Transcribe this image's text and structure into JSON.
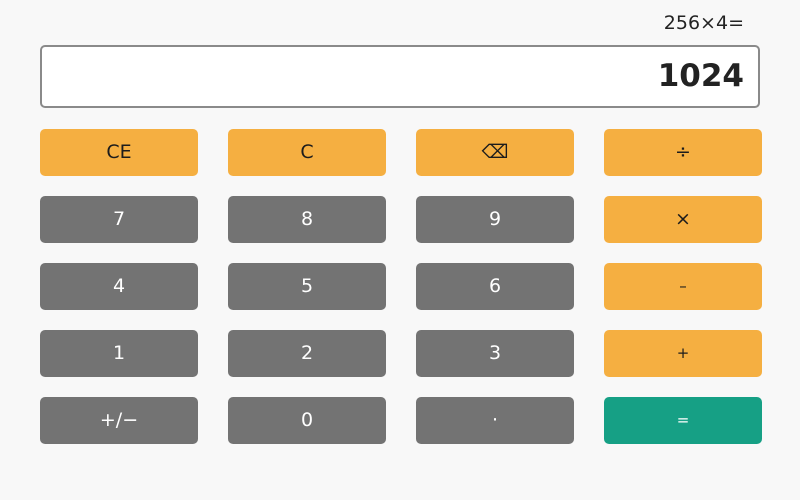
{
  "expression": "256×4=",
  "display": {
    "value": "1024"
  },
  "colors": {
    "operator": "#f5af41",
    "number": "#737373",
    "equals": "#16a085",
    "background": "#f8f8f8",
    "display_border": "#8a8a8a"
  },
  "keys": {
    "ce": "CE",
    "c": "C",
    "backspace": "⌫",
    "divide": "÷",
    "seven": "7",
    "eight": "8",
    "nine": "9",
    "multiply": "×",
    "four": "4",
    "five": "5",
    "six": "6",
    "minus": "–",
    "one": "1",
    "two": "2",
    "three": "3",
    "plus": "+",
    "negate": "+/−",
    "zero": "0",
    "decimal": "·",
    "equals": "="
  },
  "icons": {
    "backspace": "backspace-icon"
  }
}
